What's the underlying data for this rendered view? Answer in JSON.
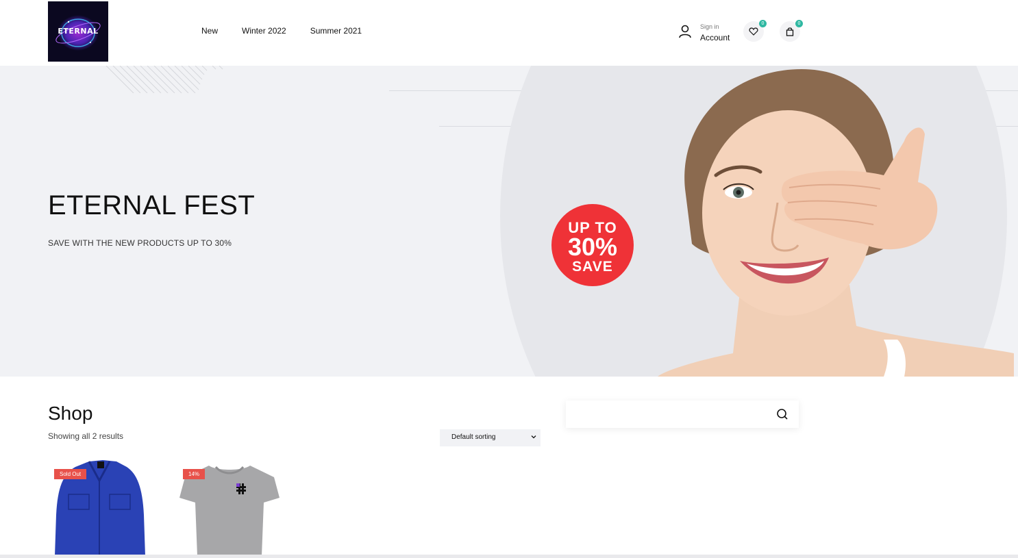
{
  "header": {
    "logo_text": "ETERNAL",
    "nav": [
      "New",
      "Winter 2022",
      "Summer 2021"
    ],
    "account": {
      "small_label": "Sign in",
      "label": "Account"
    },
    "wishlist_count": "0",
    "cart_count": "0"
  },
  "hero": {
    "title": "ETERNAL FEST",
    "subtitle": "SAVE WITH THE NEW PRODUCTS UP TO 30%",
    "promo": {
      "line1": "UP TO",
      "line2": "30%",
      "line3": "SAVE"
    }
  },
  "shop": {
    "title": "Shop",
    "results": "Showing all 2 results",
    "sorting": "Default sorting",
    "search_placeholder": "",
    "products": [
      {
        "tag": "Sold Out",
        "image": "blue-jacket"
      },
      {
        "tag": "14%",
        "image": "grey-tshirt"
      }
    ]
  },
  "colors": {
    "accent": "#2fb8a2",
    "sale_tag": "#e8514a",
    "promo_red": "#ef3237",
    "hero_bg": "#f1f2f5"
  }
}
